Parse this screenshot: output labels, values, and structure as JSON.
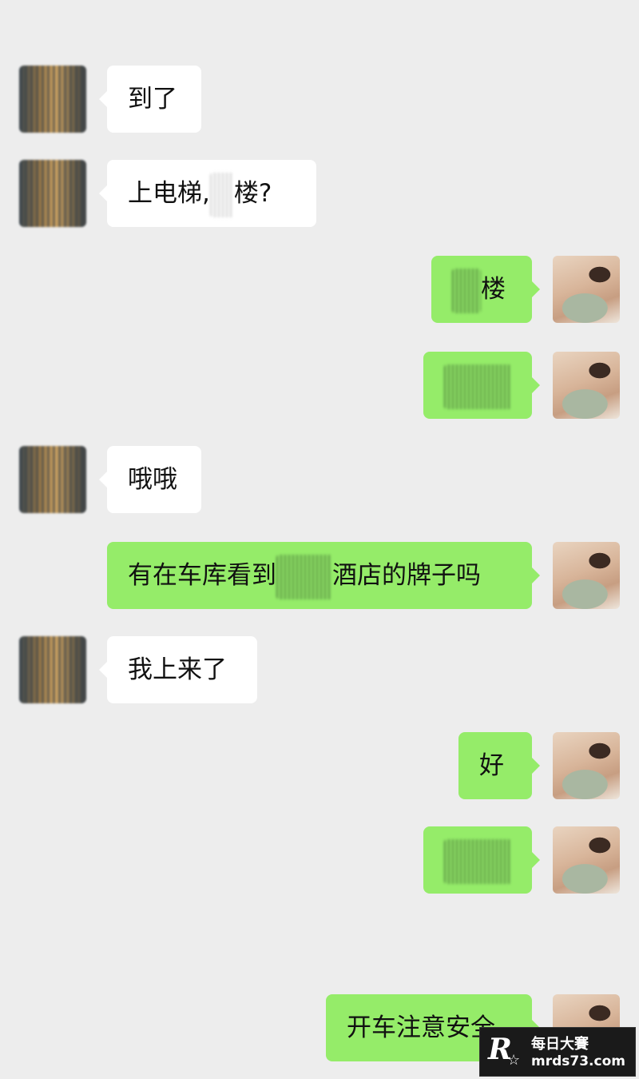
{
  "messages": [
    {
      "side": "left",
      "text": "到了"
    },
    {
      "side": "left",
      "text_before": "上电梯,",
      "text_after": "楼?"
    },
    {
      "side": "right",
      "text": "楼"
    },
    {
      "side": "right",
      "text": ""
    },
    {
      "side": "left",
      "text": "哦哦"
    },
    {
      "side": "right",
      "text_before": "有在车库看到",
      "text_after": "酒店的牌子吗"
    },
    {
      "side": "left",
      "text": "我上来了"
    },
    {
      "side": "right",
      "text": "好"
    },
    {
      "side": "right",
      "text": ""
    },
    {
      "side": "right",
      "text": "开车注意安全"
    }
  ],
  "watermark": {
    "logo": "R",
    "star": "☆",
    "title": "每日大賽",
    "url": "mrds73.com"
  },
  "colors": {
    "background": "#ededed",
    "incoming_bubble": "#ffffff",
    "outgoing_bubble": "#95ec69"
  }
}
